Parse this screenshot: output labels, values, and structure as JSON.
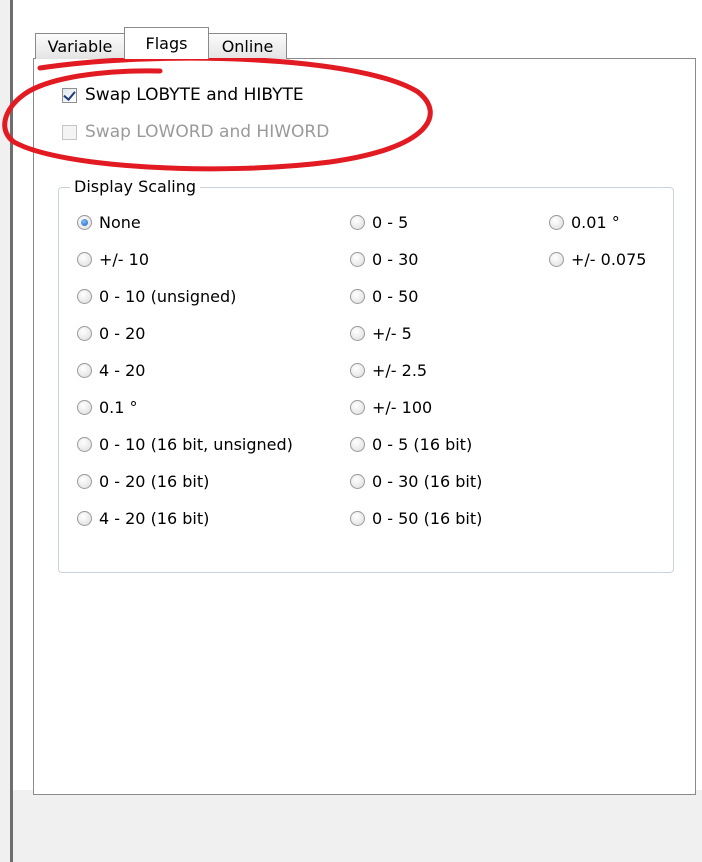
{
  "tabs": [
    {
      "label": "Variable",
      "active": false
    },
    {
      "label": "Flags",
      "active": true
    },
    {
      "label": "Online",
      "active": false
    }
  ],
  "flags": {
    "swap_bytes": {
      "label": "Swap LOBYTE and HIBYTE",
      "checked": true,
      "enabled": true
    },
    "swap_words": {
      "label": "Swap LOWORD and HIWORD",
      "checked": false,
      "enabled": false
    }
  },
  "display_scaling": {
    "title": "Display Scaling",
    "selected": "None",
    "col1": [
      "None",
      "+/- 10",
      "0 - 10 (unsigned)",
      "0 - 20",
      "4 - 20",
      "0.1 °",
      "0 - 10 (16 bit, unsigned)",
      "0 - 20 (16 bit)",
      "4 - 20 (16 bit)"
    ],
    "col2": [
      "0 - 5",
      "0 - 30",
      "0 - 50",
      "+/- 5",
      "+/- 2.5",
      "+/- 100",
      "0 - 5 (16 bit)",
      "0 - 30 (16 bit)",
      "0 - 50 (16 bit)"
    ],
    "col3": [
      "0.01 °",
      "+/- 0.075"
    ]
  },
  "colors": {
    "annotation": "#e21b23",
    "radio_selected": "#1f5fb8"
  }
}
